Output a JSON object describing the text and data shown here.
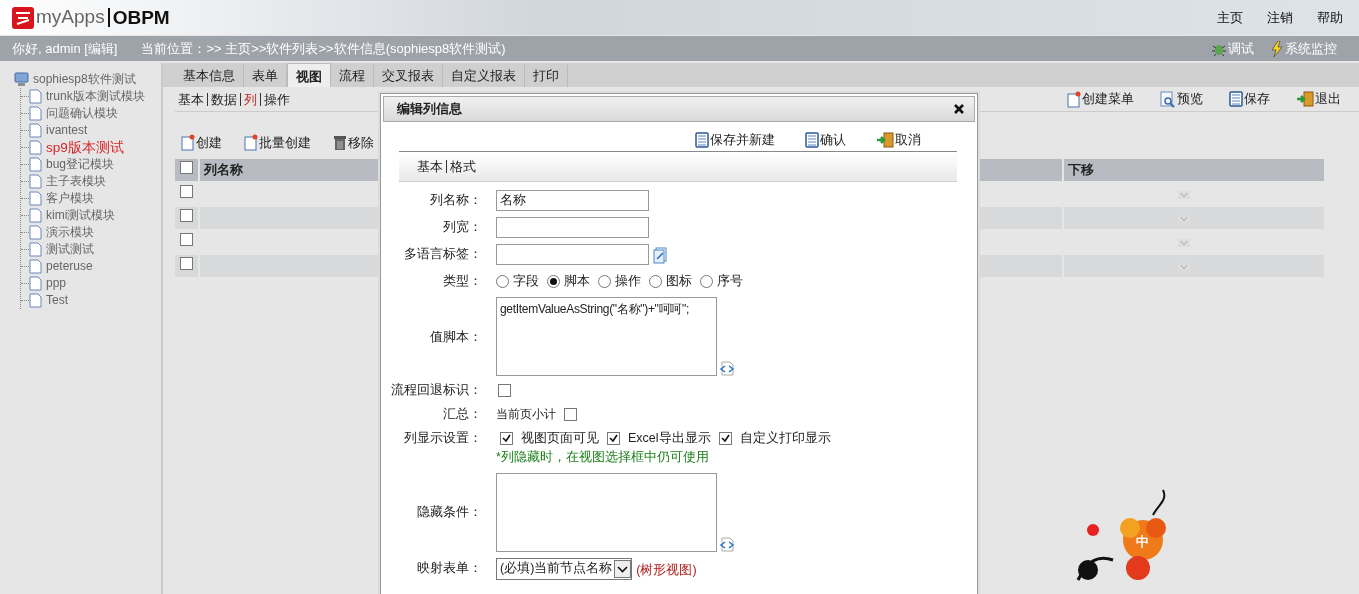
{
  "header": {
    "logo_text": "myApps",
    "logo_product": "OBPM",
    "links": [
      "主页",
      "注销",
      "帮助"
    ]
  },
  "status_bar": {
    "greeting": "你好, admin [编辑]",
    "location": "当前位置：>> 主页>>软件列表>>软件信息(sophiesp8软件测试)",
    "tools": [
      "调试",
      "系统监控"
    ]
  },
  "sidebar": {
    "tree": [
      {
        "label": "sophiesp8软件测试",
        "selected": false,
        "children": [
          {
            "label": "trunk版本测试模块",
            "selected": false
          },
          {
            "label": "问题确认模块",
            "selected": false
          },
          {
            "label": "ivantest",
            "selected": false
          },
          {
            "label": "sp9版本测试",
            "selected": true
          },
          {
            "label": "bug登记模块",
            "selected": false
          },
          {
            "label": "主子表模块",
            "selected": false
          },
          {
            "label": "客户模块",
            "selected": false
          },
          {
            "label": "kimi测试模块",
            "selected": false
          },
          {
            "label": "演示模块",
            "selected": false
          },
          {
            "label": "测试测试",
            "selected": false
          },
          {
            "label": "peteruse",
            "selected": false
          },
          {
            "label": "ppp",
            "selected": false
          },
          {
            "label": "Test",
            "selected": false
          }
        ]
      }
    ]
  },
  "tabs": [
    {
      "label": "基本信息",
      "selected": false
    },
    {
      "label": "表单",
      "selected": false
    },
    {
      "label": "视图",
      "selected": true
    },
    {
      "label": "流程",
      "selected": false
    },
    {
      "label": "交叉报表",
      "selected": false
    },
    {
      "label": "自定义报表",
      "selected": false
    },
    {
      "label": "打印",
      "selected": false
    }
  ],
  "subtabs": [
    {
      "label": "基本",
      "selected": false
    },
    {
      "label": "数据",
      "selected": false
    },
    {
      "label": "列",
      "selected": true
    },
    {
      "label": "操作",
      "selected": false
    }
  ],
  "page_actions": [
    "创建菜单",
    "预览",
    "保存",
    "退出"
  ],
  "list_toolbar": [
    "创建",
    "批量创建",
    "移除"
  ],
  "table": {
    "columns": [
      "列名称",
      "下移"
    ],
    "all_checked": false,
    "rows": [
      {
        "checked": false
      },
      {
        "checked": false
      },
      {
        "checked": false
      },
      {
        "checked": false
      }
    ]
  },
  "dialog": {
    "title": "编辑列信息",
    "actions": [
      "保存并新建",
      "确认",
      "取消"
    ],
    "tabs": [
      "基本",
      "格式"
    ],
    "fields": [
      {
        "kind": "text",
        "label": "列名称：",
        "value": "名称"
      },
      {
        "kind": "text",
        "label": "列宽："
      },
      {
        "kind": "text_picker",
        "label": "多语言标签："
      },
      {
        "kind": "radio",
        "label": "类型：",
        "options": [
          {
            "label": "字段",
            "selected": false
          },
          {
            "label": "脚本",
            "selected": true
          },
          {
            "label": "操作",
            "selected": false
          },
          {
            "label": "图标",
            "selected": false
          },
          {
            "label": "序号",
            "selected": false
          }
        ]
      },
      {
        "kind": "textarea",
        "label": "值脚本：",
        "value": "getItemValueAsString(\"名称\")+\"呵呵\";"
      },
      {
        "kind": "checkbox",
        "label": "流程回退标识：",
        "checked": false
      },
      {
        "kind": "checkbox",
        "label": "汇总：",
        "text": "当前页小计",
        "checked": false
      },
      {
        "kind": "checkgroup",
        "label": "列显示设置：",
        "options": [
          {
            "label": "视图页面可见",
            "checked": true
          },
          {
            "label": "Excel导出显示",
            "checked": true
          },
          {
            "label": "自定义打印显示",
            "checked": true
          }
        ],
        "note": "*列隐藏时，在视图选择框中仍可使用"
      },
      {
        "kind": "textarea",
        "label": "隐藏条件："
      },
      {
        "kind": "select",
        "label": "映射表单：",
        "value": "(必填)当前节点名称",
        "note": "(树形视图)"
      }
    ]
  },
  "decoration": {
    "label": "中"
  }
}
